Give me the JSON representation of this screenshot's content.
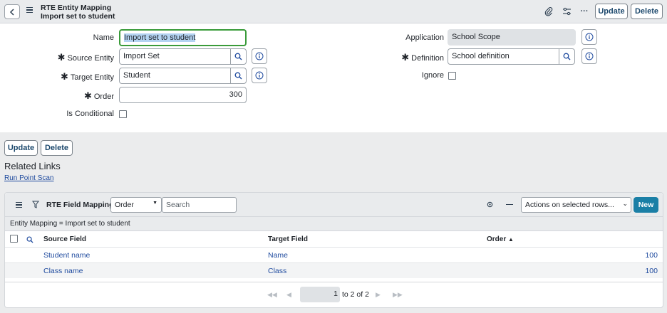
{
  "header": {
    "title": "RTE Entity Mapping",
    "subtitle": "Import set to student",
    "update_label": "Update",
    "delete_label": "Delete",
    "more_label": "···"
  },
  "form": {
    "name_label": "Name",
    "name_value": "Import set to student",
    "source_label": "Source Entity",
    "source_value": "Import Set",
    "target_label": "Target Entity",
    "target_value": "Student",
    "order_label": "Order",
    "order_value": "300",
    "conditional_label": "Is Conditional",
    "application_label": "Application",
    "application_value": "School Scope",
    "definition_label": "Definition",
    "definition_value": "School definition",
    "ignore_label": "Ignore",
    "required_mark": "✱"
  },
  "bottom_buttons": {
    "update_label": "Update",
    "delete_label": "Delete"
  },
  "related": {
    "title": "Related Links",
    "link": "Run Point Scan"
  },
  "list": {
    "title": "RTE Field Mappings",
    "search_field": "Order",
    "search_placeholder": "Search",
    "actions_label": "Actions on selected rows...",
    "new_label": "New",
    "filter": "Entity Mapping = Import set to student",
    "columns": [
      "Source Field",
      "Target Field",
      "Order"
    ],
    "sort_indicator": "▲",
    "rows": [
      {
        "source": "Student name",
        "target": "Name",
        "order": "100"
      },
      {
        "source": "Class name",
        "target": "Class",
        "order": "100"
      }
    ],
    "pager": {
      "current": "1",
      "range": "to 2 of 2"
    }
  }
}
